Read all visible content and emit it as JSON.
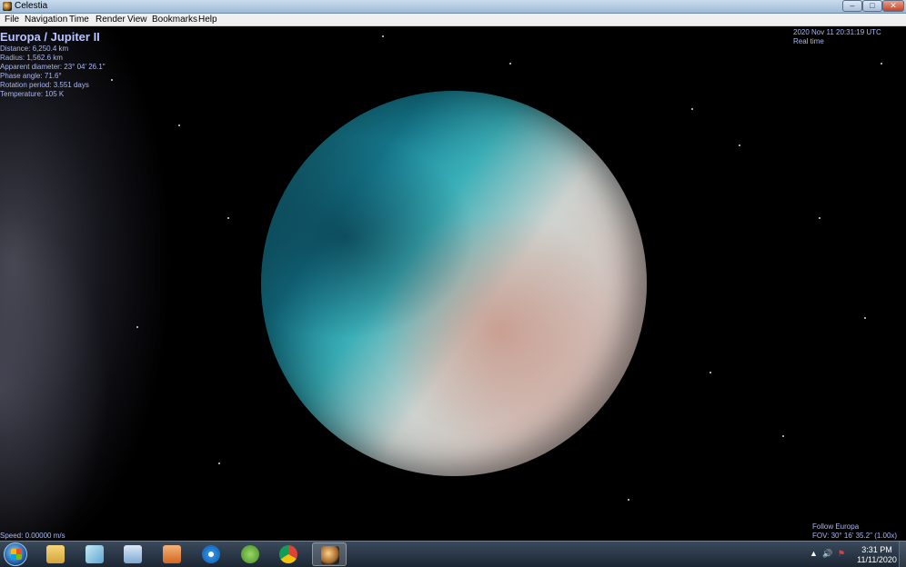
{
  "window": {
    "title": "Celestia"
  },
  "menu": [
    "File",
    "Navigation",
    "Time",
    "Render",
    "View",
    "Bookmarks",
    "Help"
  ],
  "hud": {
    "object": "Europa / Jupiter II",
    "info": [
      "Distance: 6,250.4 km",
      "Radius: 1,562.6 km",
      "Apparent diameter: 23° 04' 26.1\"",
      "Phase angle: 71.6°",
      "Rotation period: 3.551 days",
      "Temperature: 105 K"
    ],
    "datetime": "2020 Nov 11 20:31:19 UTC",
    "timescale": "Real time",
    "speed": "Speed: 0.00000 m/s",
    "follow": "Follow Europa",
    "fov": "FOV: 30° 16' 35.2\" (1.00x)"
  },
  "taskbar": {
    "items": [
      {
        "name": "file-explorer-icon",
        "color": "#e8c35a"
      },
      {
        "name": "notes-icon",
        "color": "#7ec3e6"
      },
      {
        "name": "calculator-icon",
        "color": "#9fc4e8"
      },
      {
        "name": "media-player-icon",
        "color": "#e07a2e"
      },
      {
        "name": "internet-explorer-icon",
        "color": "#1e7fd6"
      },
      {
        "name": "w-app-icon",
        "color": "#6cb33e"
      },
      {
        "name": "chrome-icon",
        "color": "#d9453a"
      },
      {
        "name": "celestia-icon",
        "color": "#c8964a"
      }
    ],
    "time": "3:31 PM",
    "date": "11/11/2020"
  },
  "colors": {
    "hud_text": "#a9b7f0",
    "hud_title": "#b9c4ff"
  }
}
